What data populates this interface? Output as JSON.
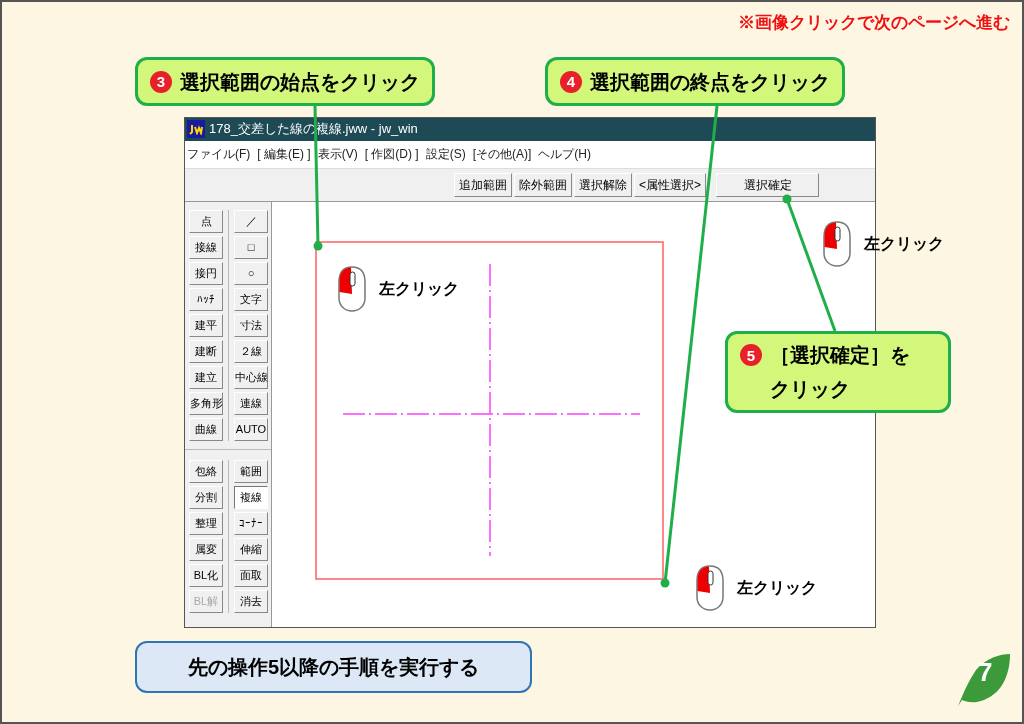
{
  "notice": "※画像クリックで次のページへ進む",
  "window": {
    "title": "178_交差した線の複線.jww - jw_win",
    "menu": [
      "ファイル(F)",
      "[ 編集(E) ]",
      "表示(V)",
      "[ 作図(D) ]",
      "設定(S)",
      "[その他(A)]",
      "ヘルプ(H)"
    ],
    "toolbar": [
      "追加範囲",
      "除外範囲",
      "選択解除",
      "<属性選択>",
      "選択確定"
    ],
    "tool_groups": [
      {
        "left": [
          {
            "label": "点",
            "selected": false,
            "disabled": false
          },
          {
            "label": "接線",
            "selected": false,
            "disabled": false
          },
          {
            "label": "接円",
            "selected": false,
            "disabled": false
          },
          {
            "label": "ﾊｯﾁ",
            "selected": false,
            "disabled": false
          },
          {
            "label": "建平",
            "selected": false,
            "disabled": false
          },
          {
            "label": "建断",
            "selected": false,
            "disabled": false
          },
          {
            "label": "建立",
            "selected": false,
            "disabled": false
          },
          {
            "label": "多角形",
            "selected": false,
            "disabled": false
          },
          {
            "label": "曲線",
            "selected": false,
            "disabled": false
          }
        ],
        "right": [
          {
            "label": "／",
            "selected": false,
            "disabled": false
          },
          {
            "label": "□",
            "selected": false,
            "disabled": false
          },
          {
            "label": "○",
            "selected": false,
            "disabled": false
          },
          {
            "label": "文字",
            "selected": false,
            "disabled": false
          },
          {
            "label": "寸法",
            "selected": false,
            "disabled": false
          },
          {
            "label": "２線",
            "selected": false,
            "disabled": false
          },
          {
            "label": "中心線",
            "selected": false,
            "disabled": false
          },
          {
            "label": "連線",
            "selected": false,
            "disabled": false
          },
          {
            "label": "AUTO",
            "selected": false,
            "disabled": false
          }
        ]
      },
      {
        "left": [
          {
            "label": "包絡",
            "selected": false,
            "disabled": false
          },
          {
            "label": "分割",
            "selected": false,
            "disabled": false
          },
          {
            "label": "整理",
            "selected": false,
            "disabled": false
          },
          {
            "label": "属変",
            "selected": false,
            "disabled": false
          },
          {
            "label": "BL化",
            "selected": false,
            "disabled": false
          },
          {
            "label": "BL解",
            "selected": false,
            "disabled": true
          }
        ],
        "right": [
          {
            "label": "範囲",
            "selected": false,
            "disabled": false
          },
          {
            "label": "複線",
            "selected": true,
            "disabled": false
          },
          {
            "label": "ｺｰﾅｰ",
            "selected": false,
            "disabled": false
          },
          {
            "label": "伸縮",
            "selected": false,
            "disabled": false
          },
          {
            "label": "面取",
            "selected": false,
            "disabled": false
          },
          {
            "label": "消去",
            "selected": false,
            "disabled": false
          }
        ]
      }
    ]
  },
  "callouts": [
    {
      "number": "3",
      "text": "選択範囲の始点をクリック"
    },
    {
      "number": "4",
      "text": "選択範囲の終点をクリック"
    },
    {
      "number": "5",
      "text": "［選択確定］をクリック"
    }
  ],
  "clicks": [
    "左クリック",
    "左クリック",
    "左クリック"
  ],
  "note": "先の操作5以降の手順を実行する",
  "page_number": "7"
}
